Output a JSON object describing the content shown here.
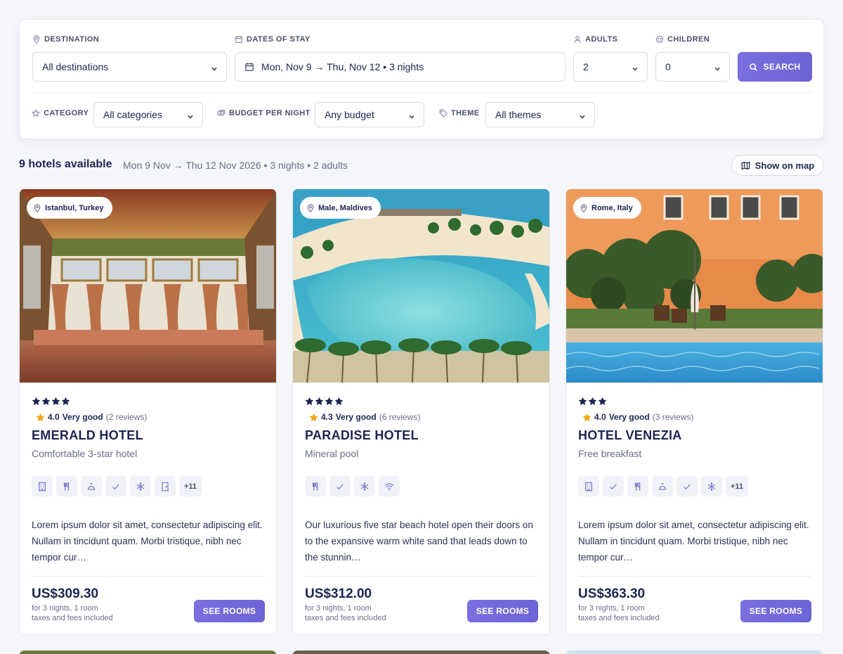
{
  "search": {
    "destination_label": "DESTINATION",
    "destination_value": "All destinations",
    "dates_label": "DATES OF STAY",
    "dates_value": "Mon, Nov 9 → Thu, Nov 12 • 3 nights",
    "adults_label": "ADULTS",
    "adults_value": "2",
    "children_label": "CHILDREN",
    "children_value": "0",
    "search_label": "SEARCH",
    "category_label": "CATEGORY",
    "category_value": "All categories",
    "budget_label": "BUDGET PER NIGHT",
    "budget_value": "Any budget",
    "theme_label": "THEME",
    "theme_value": "All themes"
  },
  "results": {
    "count": "9 hotels available",
    "meta": "Mon 9 Nov → Thu 12 Nov 2026 • 3 nights • 2 adults",
    "map_label": "Show on map"
  },
  "colors": {
    "accent": "#6c63d6",
    "navy": "#1e2452",
    "star": "#f2a516"
  },
  "hotels": [
    {
      "location": "Istanbul, Turkey",
      "stars": 4,
      "rating_score": "4.0",
      "rating_word": "Very good",
      "reviews": "(2 reviews)",
      "name": "EMERALD HOTEL",
      "subtitle": "Comfortable 3-star hotel",
      "amenities": [
        "building-icon",
        "restaurant-icon",
        "room-service-icon",
        "check-icon",
        "snowflake-icon",
        "door-icon"
      ],
      "more": "+11",
      "description": "Lorem ipsum dolor sit amet, consectetur adipiscing elit. Nullam in tincidunt quam. Morbi tristique, nibh nec tempor cur…",
      "price": "US$309.30",
      "price_note_1": "for 3 nights, 1 room",
      "price_note_2": "taxes and fees included",
      "cta": "SEE ROOMS"
    },
    {
      "location": "Male, Maldives",
      "stars": 4,
      "rating_score": "4.3",
      "rating_word": "Very good",
      "reviews": "(6 reviews)",
      "name": "PARADISE HOTEL",
      "subtitle": "Mineral pool",
      "amenities": [
        "restaurant-icon",
        "check-icon",
        "snowflake-icon",
        "wifi-icon"
      ],
      "more": "",
      "description": "Our luxurious five star beach hotel open their doors on to the expansive warm white sand that leads down to the stunnin…",
      "price": "US$312.00",
      "price_note_1": "for 3 nights, 1 room",
      "price_note_2": "taxes and fees included",
      "cta": "SEE ROOMS"
    },
    {
      "location": "Rome, Italy",
      "stars": 3,
      "rating_score": "4.0",
      "rating_word": "Very good",
      "reviews": "(3 reviews)",
      "name": "HOTEL VENEZIA",
      "subtitle": "Free breakfast",
      "amenities": [
        "building-icon",
        "check-icon",
        "restaurant-icon",
        "room-service-icon",
        "check-icon",
        "snowflake-icon"
      ],
      "more": "+11",
      "description": "Lorem ipsum dolor sit amet, consectetur adipiscing elit. Nullam in tincidunt quam. Morbi tristique, nibh nec tempor cur…",
      "price": "US$363.30",
      "price_note_1": "for 3 nights, 1 room",
      "price_note_2": "taxes and fees included",
      "cta": "SEE ROOMS"
    }
  ]
}
